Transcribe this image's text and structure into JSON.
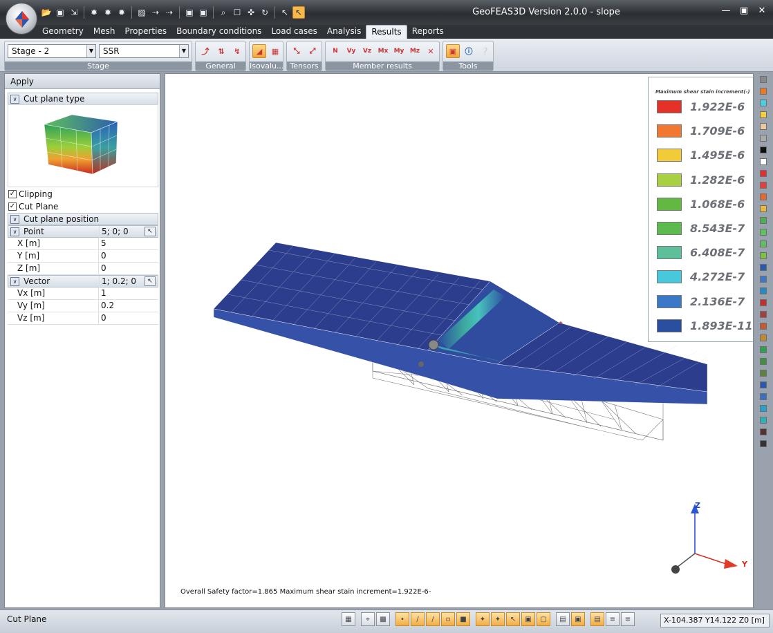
{
  "window": {
    "title": "GeoFEAS3D Version 2.0.0 - slope"
  },
  "quick_access_icons": [
    "open-icon",
    "save-icon",
    "export-icon",
    "sun-icon",
    "sun-icon",
    "sun-icon",
    "cube-icon",
    "select-icon",
    "select-icon",
    "camera-icon",
    "camera-icon",
    "zoom-icon",
    "zoom-window-icon",
    "pan-icon",
    "rotate-icon",
    "pointer-icon",
    "pointer-icon"
  ],
  "menu": {
    "tabs": [
      {
        "label": "Geometry",
        "active": false
      },
      {
        "label": "Mesh",
        "active": false
      },
      {
        "label": "Properties",
        "active": false
      },
      {
        "label": "Boundary conditions",
        "active": false
      },
      {
        "label": "Load cases",
        "active": false
      },
      {
        "label": "Analysis",
        "active": false
      },
      {
        "label": "Results",
        "active": true
      },
      {
        "label": "Reports",
        "active": false
      }
    ]
  },
  "ribbon": {
    "stage_combo": "Stage  - 2",
    "analysis_combo": "SSR",
    "groups": {
      "stage": "Stage",
      "general": "General",
      "isovalue": "Isovalu...",
      "tensors": "Tensors",
      "member_results": "Member results",
      "tools": "Tools"
    },
    "member_buttons": [
      "N",
      "Vy",
      "Vz",
      "Mx",
      "My",
      "Mz"
    ]
  },
  "left_panel": {
    "apply": "Apply",
    "cut_plane_type": "Cut plane type",
    "clipping_label": "Clipping",
    "clipping_checked": true,
    "cut_plane_label": "Cut Plane",
    "cut_plane_checked": true,
    "cut_plane_position": "Cut plane position",
    "point": {
      "label": "Point",
      "value": "5; 0; 0"
    },
    "x": {
      "label": "X  [m]",
      "value": "5"
    },
    "y": {
      "label": "Y  [m]",
      "value": "0"
    },
    "z": {
      "label": "Z  [m]",
      "value": "0"
    },
    "vector": {
      "label": "Vector",
      "value": "1; 0.2; 0"
    },
    "vx": {
      "label": "Vx  [m]",
      "value": "1"
    },
    "vy": {
      "label": "Vy  [m]",
      "value": "0.2"
    },
    "vz": {
      "label": "Vz  [m]",
      "value": "0"
    }
  },
  "legend": {
    "title": "Maximum shear stain increment(-)",
    "entries": [
      {
        "label": "1.922E-6",
        "color": "#e53228"
      },
      {
        "label": "1.709E-6",
        "color": "#f07830"
      },
      {
        "label": "1.495E-6",
        "color": "#f2cc38"
      },
      {
        "label": "1.282E-6",
        "color": "#a8d040"
      },
      {
        "label": "1.068E-6",
        "color": "#62b840"
      },
      {
        "label": "8.543E-7",
        "color": "#5cbb4c"
      },
      {
        "label": "6.408E-7",
        "color": "#5ec09a"
      },
      {
        "label": "4.272E-7",
        "color": "#48c8dc"
      },
      {
        "label": "2.136E-7",
        "color": "#3a78c8"
      },
      {
        "label": "1.893E-11",
        "color": "#2b4fa0"
      }
    ]
  },
  "viewport": {
    "status": "Overall Safety factor=1.865  Maximum shear stain increment=1.922E-6-",
    "axis_z": "Z",
    "axis_y": "Y"
  },
  "palette_colors": [
    "#8a8a8a",
    "#e87a2a",
    "#4ad0e0",
    "#f0d040",
    "#e9c9a0",
    "#aaaaaa",
    "#111111",
    "#ffffff",
    "#e03030",
    "#e04040",
    "#e06a30",
    "#e8b840",
    "#50b050",
    "#60c060",
    "#60c060",
    "#80c040",
    "#2a5aa8",
    "#3f78c0",
    "#2a8ac0",
    "#c03030",
    "#a04040",
    "#c05a30",
    "#c08a30",
    "#30a050",
    "#409040",
    "#608040",
    "#2a58b0",
    "#3a70c0",
    "#2aa0c8",
    "#30b0b0",
    "#553333",
    "#333333"
  ],
  "statusbar": {
    "left": "Cut Plane",
    "coords": "X-104.387 Y14.122 Z0 [m]"
  }
}
